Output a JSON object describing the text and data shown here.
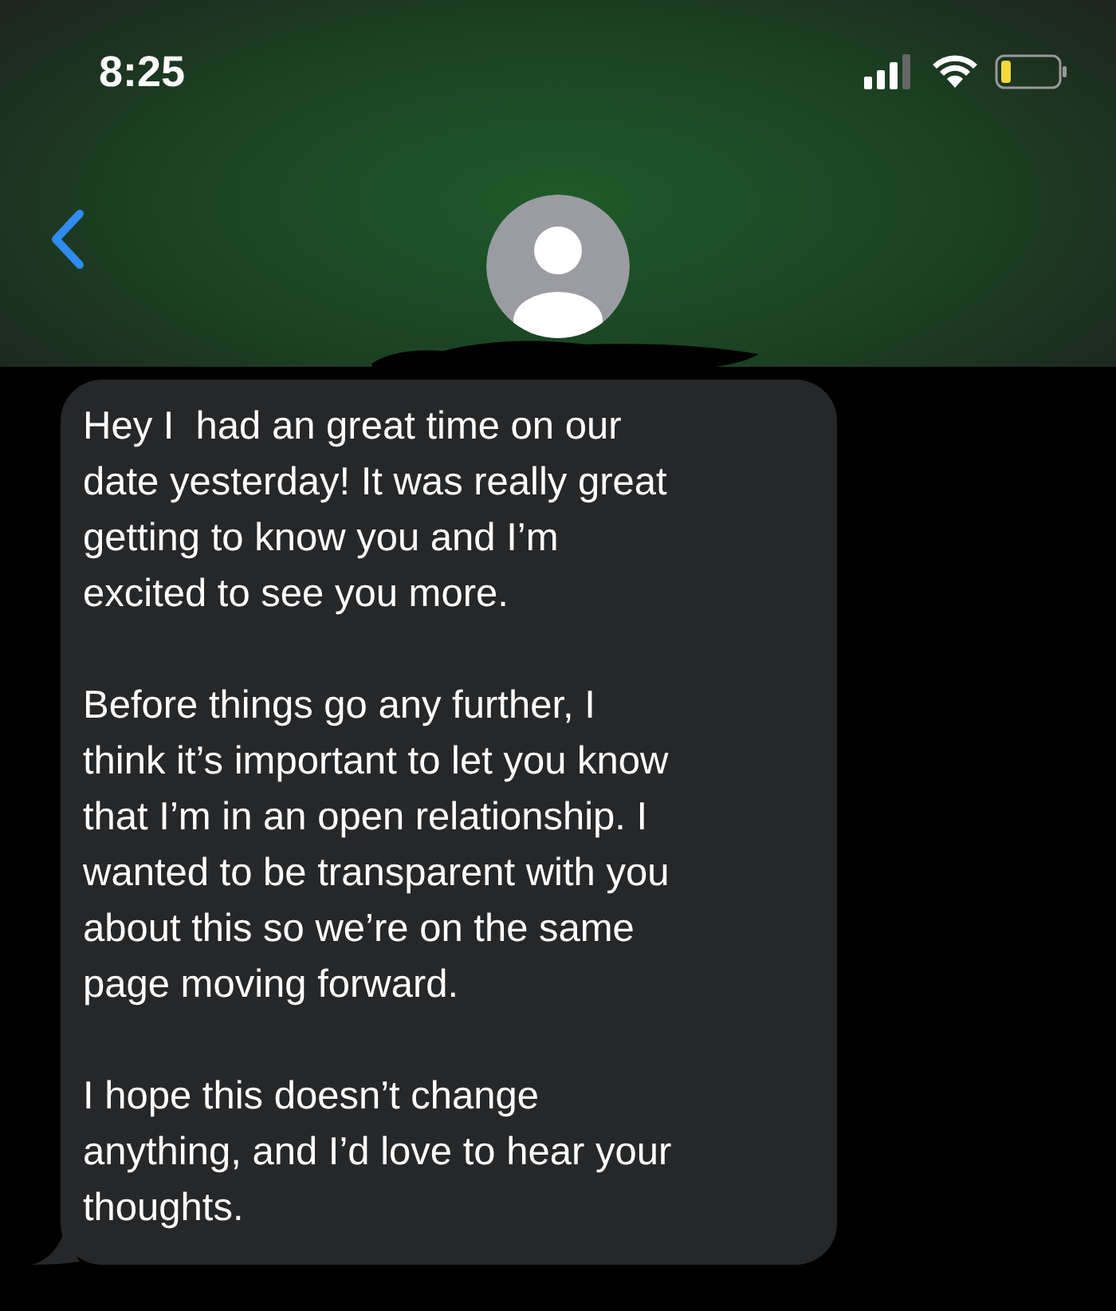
{
  "status_bar": {
    "time": "8:25"
  },
  "message": {
    "paragraphs": [
      "Hey I  had an great time on our\ndate yesterday! It was really great\ngetting to know you and I’m\nexcited to see you more.",
      "Before things go any further, I\nthink it’s important to let you know\nthat I’m in an open relationship. I\nwanted to be transparent with you\nabout this so we’re on the same\npage moving forward.",
      "I hope this doesn’t change\nanything, and I’d love to hear your\nthoughts."
    ]
  }
}
